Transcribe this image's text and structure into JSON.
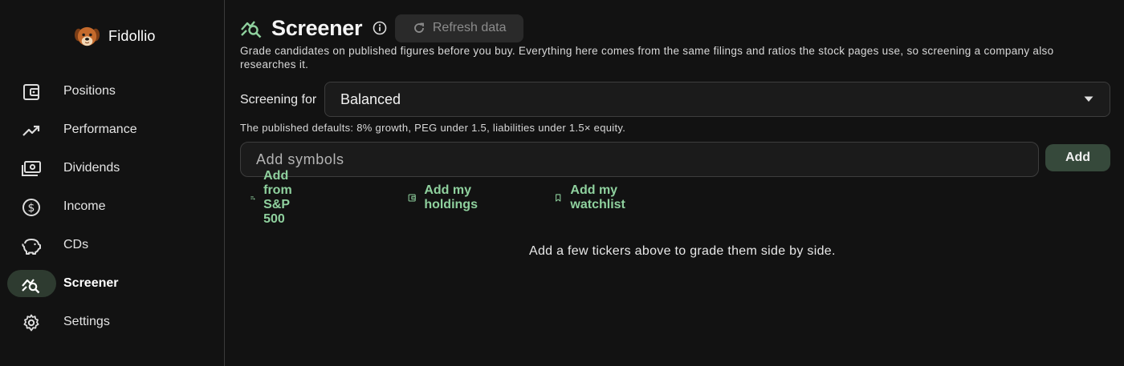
{
  "app": {
    "name": "Fidollio"
  },
  "sidebar": {
    "items": [
      {
        "label": "Positions",
        "icon": "wallet-icon"
      },
      {
        "label": "Performance",
        "icon": "trending-up-icon"
      },
      {
        "label": "Dividends",
        "icon": "payments-icon"
      },
      {
        "label": "Income",
        "icon": "dollar-circle-icon"
      },
      {
        "label": "CDs",
        "icon": "piggy-bank-icon"
      },
      {
        "label": "Screener",
        "icon": "query-stats-icon",
        "active": true
      },
      {
        "label": "Settings",
        "icon": "gear-icon"
      }
    ]
  },
  "header": {
    "title": "Screener",
    "refresh_label": "Refresh data"
  },
  "main": {
    "description": "Grade candidates on published figures before you buy. Everything here comes from the same filings and ratios the stock pages use, so screening a company also researches it.",
    "screening_label": "Screening for",
    "screening_value": "Balanced",
    "defaults_text": "The published defaults: 8% growth, PEG under 1.5, liabilities under 1.5× equity.",
    "symbols_placeholder": "Add symbols",
    "add_label": "Add",
    "quick_add": [
      {
        "label": "Add from S&P 500",
        "icon": "playlist-add-icon"
      },
      {
        "label": "Add my holdings",
        "icon": "wallet-icon"
      },
      {
        "label": "Add my watchlist",
        "icon": "bookmark-icon"
      }
    ],
    "empty_message": "Add a few tickers above to grade them side by side."
  },
  "colors": {
    "background": "#121212",
    "accent": "#8fd19e",
    "active_nav": "#2e3b30",
    "add_button": "#36493b"
  }
}
